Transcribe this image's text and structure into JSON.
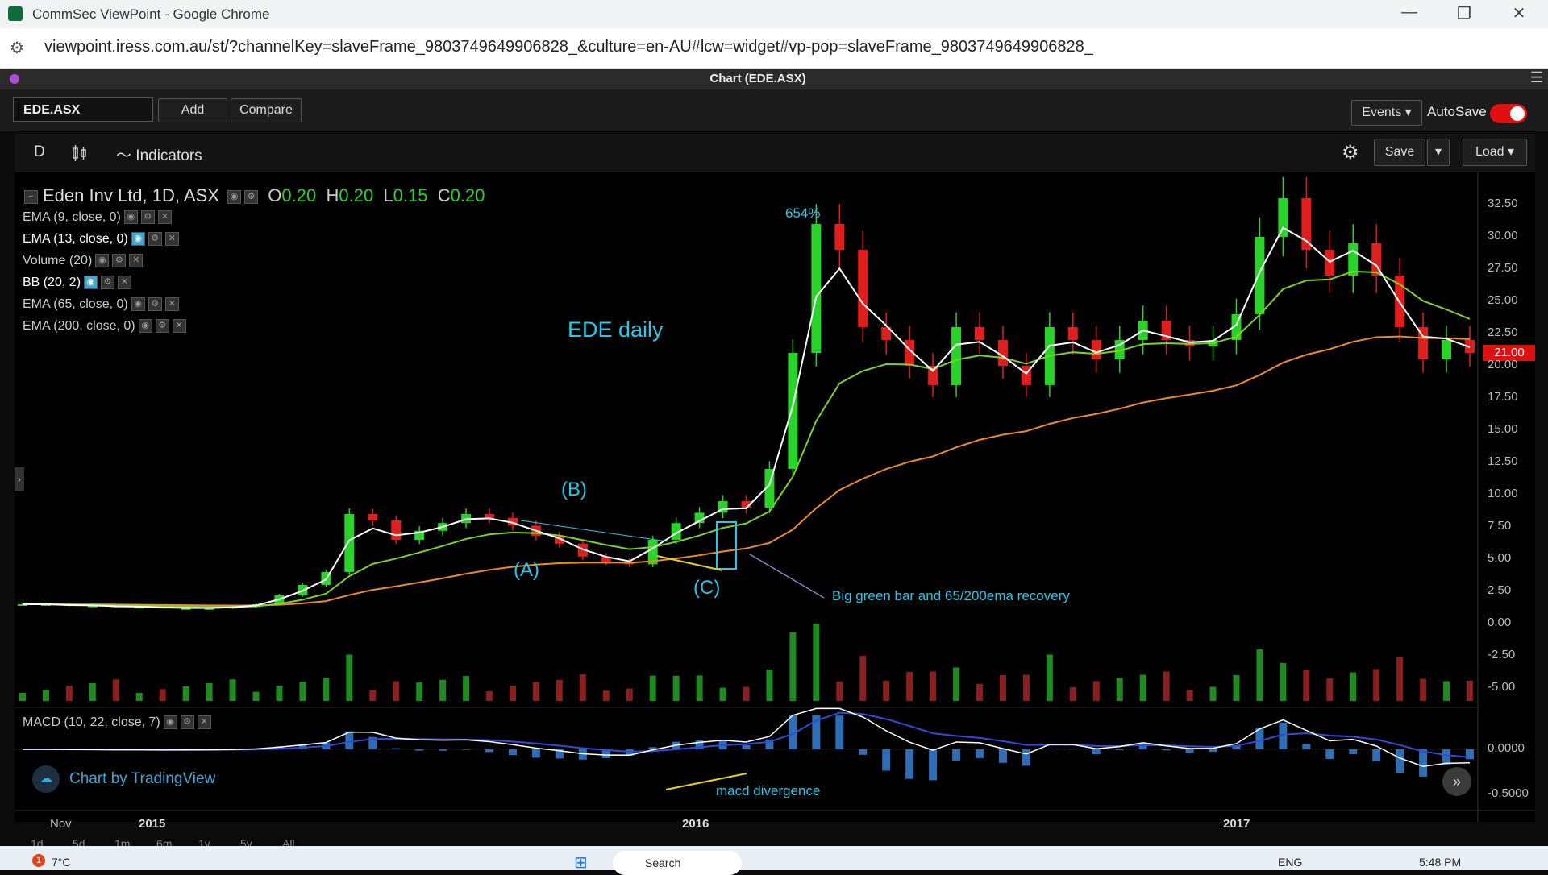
{
  "window": {
    "title": "CommSec ViewPoint - Google Chrome",
    "minimize": "—",
    "restore": "❐",
    "close": "✕"
  },
  "address": {
    "url": "viewpoint.iress.com.au/st/?channelKey=slaveFrame_9803749649906828_&culture=en-AU#lcw=widget#vp-pop=slaveFrame_9803749649906828_"
  },
  "app": {
    "chart_title": "Chart (EDE.ASX)"
  },
  "toolbar": {
    "symbol": "EDE.ASX",
    "add": "Add",
    "compare": "Compare",
    "events": "Events ▾",
    "autosave": "AutoSave"
  },
  "chart_toolbar": {
    "interval": "D",
    "indicators": "Indicators",
    "save": "Save",
    "load": "Load ▾",
    "save_caret": "▾"
  },
  "legend": {
    "name": "Eden Inv Ltd, 1D, ASX",
    "o_label": "O",
    "o": "0.20",
    "h_label": "H",
    "h": "0.20",
    "l_label": "L",
    "l": "0.15",
    "c_label": "C",
    "c": "0.20"
  },
  "indicators": [
    "EMA (9, close, 0)",
    "EMA (13, close, 0)",
    "Volume (20)",
    "BB (20, 2)",
    "EMA (65, close, 0)",
    "EMA (200, close, 0)"
  ],
  "annotations": {
    "percent": "654%",
    "heading": "EDE daily",
    "a": "(A)",
    "b": "(B)",
    "c": "(C)",
    "big_green": "Big green bar and 65/200ema recovery",
    "macd_div": "macd divergence"
  },
  "price_label": "21.00",
  "macd": {
    "label": "MACD (10, 22, close, 7)",
    "ticks": [
      "0.0000",
      "-0.5000"
    ]
  },
  "brand": {
    "text": "Chart by TradingView"
  },
  "ranges": [
    "1d",
    "5d",
    "1m",
    "6m",
    "1y",
    "5y",
    "All"
  ],
  "taskbar": {
    "temp": "7°C",
    "badge": "1",
    "search": "Search",
    "lang": "ENG",
    "time": "5:48 PM"
  },
  "chart_data": {
    "type": "line",
    "title": "",
    "xlabel": "",
    "ylabel": "",
    "ylim": [
      -6.5,
      35
    ],
    "y_ticks": [
      "32.50",
      "30.00",
      "27.50",
      "25.00",
      "22.50",
      "20.00",
      "17.50",
      "15.00",
      "12.50",
      "10.00",
      "7.50",
      "5.00",
      "2.50",
      "0.00",
      "-2.50",
      "-5.00"
    ],
    "x_ticks": [
      {
        "label": "Nov",
        "bold": false
      },
      {
        "label": "2015",
        "bold": true
      },
      {
        "label": "2016",
        "bold": true
      },
      {
        "label": "2017",
        "bold": true
      }
    ],
    "series": [
      {
        "name": "",
        "values": [
          1.5,
          1.5,
          1.4,
          1.4,
          1.3,
          1.3,
          1.2,
          1.2,
          1.2,
          1.3,
          1.5,
          2.2,
          3.0,
          4.0,
          8.5,
          8.0,
          6.5,
          7.2,
          7.8,
          8.5,
          8.2,
          7.6,
          6.8,
          6.2,
          5.2,
          4.8,
          4.6,
          6.5,
          7.8,
          8.6,
          9.5,
          9.0,
          12.0,
          21.0,
          31.0,
          29.0,
          23.0,
          22.0,
          20.0,
          18.5,
          23.0,
          22.0,
          20.0,
          18.5,
          23.0,
          22.0,
          20.5,
          22.0,
          23.5,
          22.0,
          21.5,
          22.0,
          24.0,
          30.0,
          33.0,
          29.0,
          27.0,
          29.5,
          27.0,
          23.0,
          20.5,
          22.0,
          21.0
        ]
      }
    ]
  }
}
